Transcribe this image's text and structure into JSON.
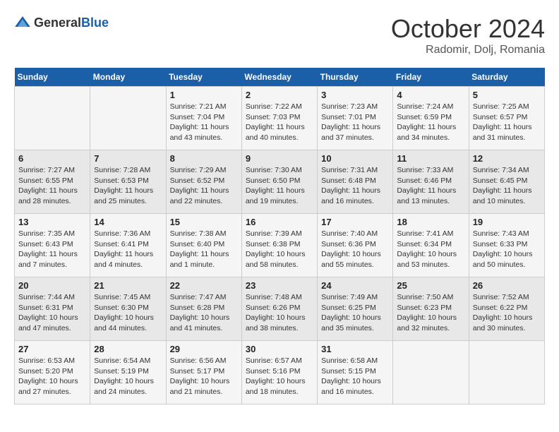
{
  "header": {
    "logo": {
      "general": "General",
      "blue": "Blue"
    },
    "title": "October 2024",
    "location": "Radomir, Dolj, Romania"
  },
  "days_of_week": [
    "Sunday",
    "Monday",
    "Tuesday",
    "Wednesday",
    "Thursday",
    "Friday",
    "Saturday"
  ],
  "weeks": [
    [
      {
        "day": "",
        "sunrise": "",
        "sunset": "",
        "daylight": ""
      },
      {
        "day": "",
        "sunrise": "",
        "sunset": "",
        "daylight": ""
      },
      {
        "day": "1",
        "sunrise": "Sunrise: 7:21 AM",
        "sunset": "Sunset: 7:04 PM",
        "daylight": "Daylight: 11 hours and 43 minutes."
      },
      {
        "day": "2",
        "sunrise": "Sunrise: 7:22 AM",
        "sunset": "Sunset: 7:03 PM",
        "daylight": "Daylight: 11 hours and 40 minutes."
      },
      {
        "day": "3",
        "sunrise": "Sunrise: 7:23 AM",
        "sunset": "Sunset: 7:01 PM",
        "daylight": "Daylight: 11 hours and 37 minutes."
      },
      {
        "day": "4",
        "sunrise": "Sunrise: 7:24 AM",
        "sunset": "Sunset: 6:59 PM",
        "daylight": "Daylight: 11 hours and 34 minutes."
      },
      {
        "day": "5",
        "sunrise": "Sunrise: 7:25 AM",
        "sunset": "Sunset: 6:57 PM",
        "daylight": "Daylight: 11 hours and 31 minutes."
      }
    ],
    [
      {
        "day": "6",
        "sunrise": "Sunrise: 7:27 AM",
        "sunset": "Sunset: 6:55 PM",
        "daylight": "Daylight: 11 hours and 28 minutes."
      },
      {
        "day": "7",
        "sunrise": "Sunrise: 7:28 AM",
        "sunset": "Sunset: 6:53 PM",
        "daylight": "Daylight: 11 hours and 25 minutes."
      },
      {
        "day": "8",
        "sunrise": "Sunrise: 7:29 AM",
        "sunset": "Sunset: 6:52 PM",
        "daylight": "Daylight: 11 hours and 22 minutes."
      },
      {
        "day": "9",
        "sunrise": "Sunrise: 7:30 AM",
        "sunset": "Sunset: 6:50 PM",
        "daylight": "Daylight: 11 hours and 19 minutes."
      },
      {
        "day": "10",
        "sunrise": "Sunrise: 7:31 AM",
        "sunset": "Sunset: 6:48 PM",
        "daylight": "Daylight: 11 hours and 16 minutes."
      },
      {
        "day": "11",
        "sunrise": "Sunrise: 7:33 AM",
        "sunset": "Sunset: 6:46 PM",
        "daylight": "Daylight: 11 hours and 13 minutes."
      },
      {
        "day": "12",
        "sunrise": "Sunrise: 7:34 AM",
        "sunset": "Sunset: 6:45 PM",
        "daylight": "Daylight: 11 hours and 10 minutes."
      }
    ],
    [
      {
        "day": "13",
        "sunrise": "Sunrise: 7:35 AM",
        "sunset": "Sunset: 6:43 PM",
        "daylight": "Daylight: 11 hours and 7 minutes."
      },
      {
        "day": "14",
        "sunrise": "Sunrise: 7:36 AM",
        "sunset": "Sunset: 6:41 PM",
        "daylight": "Daylight: 11 hours and 4 minutes."
      },
      {
        "day": "15",
        "sunrise": "Sunrise: 7:38 AM",
        "sunset": "Sunset: 6:40 PM",
        "daylight": "Daylight: 11 hours and 1 minute."
      },
      {
        "day": "16",
        "sunrise": "Sunrise: 7:39 AM",
        "sunset": "Sunset: 6:38 PM",
        "daylight": "Daylight: 10 hours and 58 minutes."
      },
      {
        "day": "17",
        "sunrise": "Sunrise: 7:40 AM",
        "sunset": "Sunset: 6:36 PM",
        "daylight": "Daylight: 10 hours and 55 minutes."
      },
      {
        "day": "18",
        "sunrise": "Sunrise: 7:41 AM",
        "sunset": "Sunset: 6:34 PM",
        "daylight": "Daylight: 10 hours and 53 minutes."
      },
      {
        "day": "19",
        "sunrise": "Sunrise: 7:43 AM",
        "sunset": "Sunset: 6:33 PM",
        "daylight": "Daylight: 10 hours and 50 minutes."
      }
    ],
    [
      {
        "day": "20",
        "sunrise": "Sunrise: 7:44 AM",
        "sunset": "Sunset: 6:31 PM",
        "daylight": "Daylight: 10 hours and 47 minutes."
      },
      {
        "day": "21",
        "sunrise": "Sunrise: 7:45 AM",
        "sunset": "Sunset: 6:30 PM",
        "daylight": "Daylight: 10 hours and 44 minutes."
      },
      {
        "day": "22",
        "sunrise": "Sunrise: 7:47 AM",
        "sunset": "Sunset: 6:28 PM",
        "daylight": "Daylight: 10 hours and 41 minutes."
      },
      {
        "day": "23",
        "sunrise": "Sunrise: 7:48 AM",
        "sunset": "Sunset: 6:26 PM",
        "daylight": "Daylight: 10 hours and 38 minutes."
      },
      {
        "day": "24",
        "sunrise": "Sunrise: 7:49 AM",
        "sunset": "Sunset: 6:25 PM",
        "daylight": "Daylight: 10 hours and 35 minutes."
      },
      {
        "day": "25",
        "sunrise": "Sunrise: 7:50 AM",
        "sunset": "Sunset: 6:23 PM",
        "daylight": "Daylight: 10 hours and 32 minutes."
      },
      {
        "day": "26",
        "sunrise": "Sunrise: 7:52 AM",
        "sunset": "Sunset: 6:22 PM",
        "daylight": "Daylight: 10 hours and 30 minutes."
      }
    ],
    [
      {
        "day": "27",
        "sunrise": "Sunrise: 6:53 AM",
        "sunset": "Sunset: 5:20 PM",
        "daylight": "Daylight: 10 hours and 27 minutes."
      },
      {
        "day": "28",
        "sunrise": "Sunrise: 6:54 AM",
        "sunset": "Sunset: 5:19 PM",
        "daylight": "Daylight: 10 hours and 24 minutes."
      },
      {
        "day": "29",
        "sunrise": "Sunrise: 6:56 AM",
        "sunset": "Sunset: 5:17 PM",
        "daylight": "Daylight: 10 hours and 21 minutes."
      },
      {
        "day": "30",
        "sunrise": "Sunrise: 6:57 AM",
        "sunset": "Sunset: 5:16 PM",
        "daylight": "Daylight: 10 hours and 18 minutes."
      },
      {
        "day": "31",
        "sunrise": "Sunrise: 6:58 AM",
        "sunset": "Sunset: 5:15 PM",
        "daylight": "Daylight: 10 hours and 16 minutes."
      },
      {
        "day": "",
        "sunrise": "",
        "sunset": "",
        "daylight": ""
      },
      {
        "day": "",
        "sunrise": "",
        "sunset": "",
        "daylight": ""
      }
    ]
  ]
}
